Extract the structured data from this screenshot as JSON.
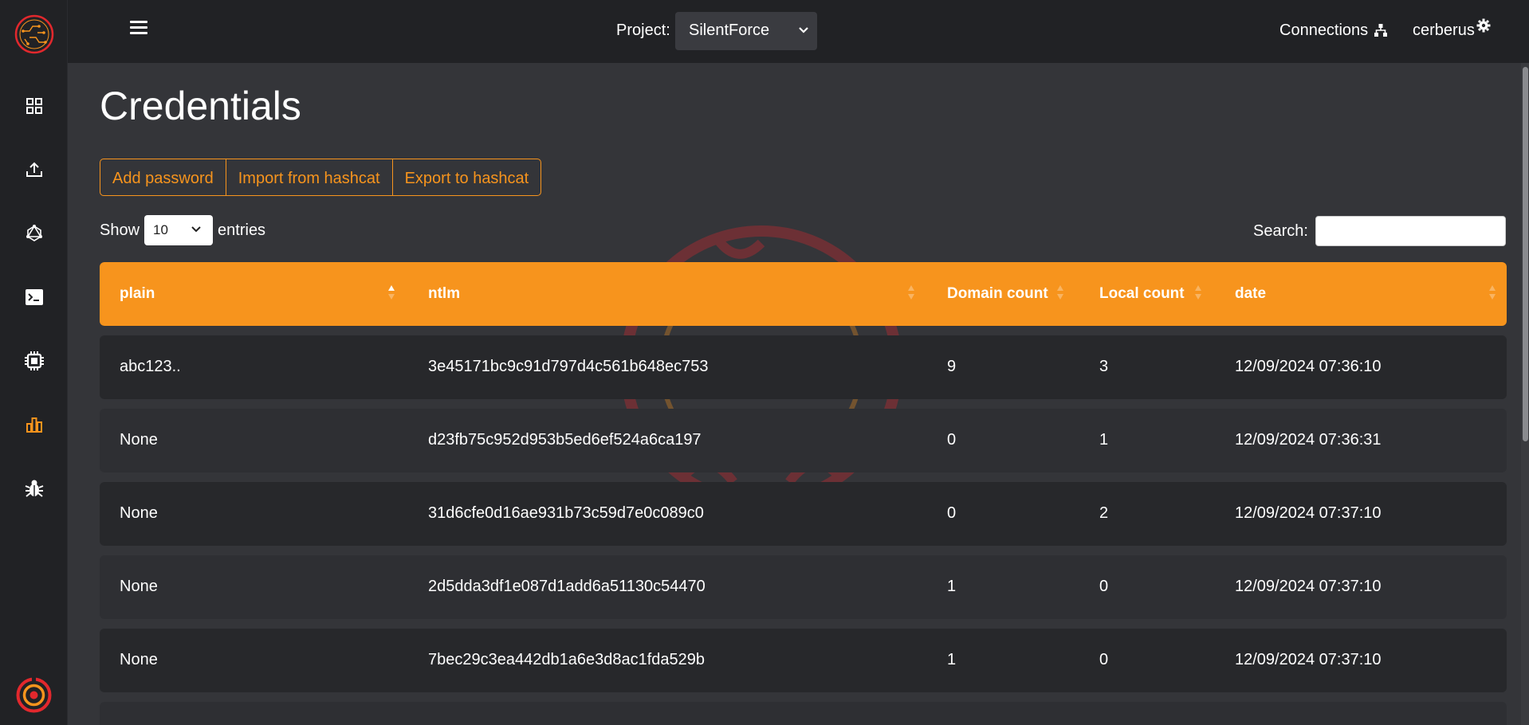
{
  "topbar": {
    "project_label": "Project:",
    "project_value": "SilentForce",
    "connections_label": "Connections",
    "username": "cerberus"
  },
  "sidebar": {
    "items": [
      {
        "icon": "dashboard-icon"
      },
      {
        "icon": "upload-icon"
      },
      {
        "icon": "graph-icon"
      },
      {
        "icon": "terminal-icon"
      },
      {
        "icon": "chip-icon"
      },
      {
        "icon": "bar-chart-icon",
        "active": true
      },
      {
        "icon": "bug-icon"
      }
    ]
  },
  "page": {
    "title": "Credentials",
    "buttons": {
      "add_password": "Add password",
      "import_hashcat": "Import from hashcat",
      "export_hashcat": "Export to hashcat"
    },
    "show_label": "Show",
    "entries_value": "10",
    "entries_label": "entries",
    "search_label": "Search:",
    "search_value": ""
  },
  "table": {
    "columns": [
      "plain",
      "ntlm",
      "Domain count",
      "Local count",
      "date"
    ],
    "rows": [
      [
        "abc123..",
        "3e45171bc9c91d797d4c561b648ec753",
        "9",
        "3",
        "12/09/2024 07:36:10"
      ],
      [
        "None",
        "d23fb75c952d953b5ed6ef524a6ca197",
        "0",
        "1",
        "12/09/2024 07:36:31"
      ],
      [
        "None",
        "31d6cfe0d16ae931b73c59d7e0c089c0",
        "0",
        "2",
        "12/09/2024 07:37:10"
      ],
      [
        "None",
        "2d5dda3df1e087d1add6a51130c54470",
        "1",
        "0",
        "12/09/2024 07:37:10"
      ],
      [
        "None",
        "7bec29c3ea442db1a6e3d8ac1fda529b",
        "1",
        "0",
        "12/09/2024 07:37:10"
      ]
    ]
  },
  "colors": {
    "accent": "#f7941d",
    "background": "#343539",
    "sidebar": "#212225"
  }
}
